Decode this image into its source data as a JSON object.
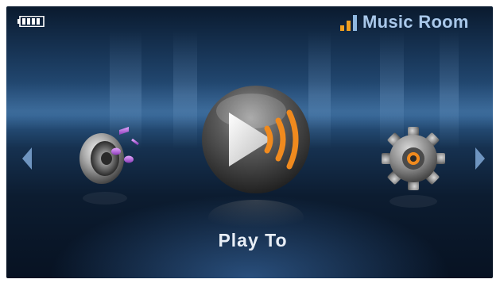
{
  "status_bar": {
    "title": "Music Room",
    "battery_icon": "battery-full-icon",
    "signal_icon": "signal-strength-icon",
    "signal_color": "#f0a020",
    "title_color": "#a9c8ea"
  },
  "carousel": {
    "items": [
      {
        "id": "music",
        "icon": "speaker-music-icon"
      },
      {
        "id": "play-to",
        "icon": "play-to-icon"
      },
      {
        "id": "settings",
        "icon": "gear-icon"
      }
    ],
    "selected_index": 1,
    "selected_label": "Play To",
    "prev_icon": "arrow-left-icon",
    "next_icon": "arrow-right-icon",
    "accent_color": "#f08a1e"
  }
}
